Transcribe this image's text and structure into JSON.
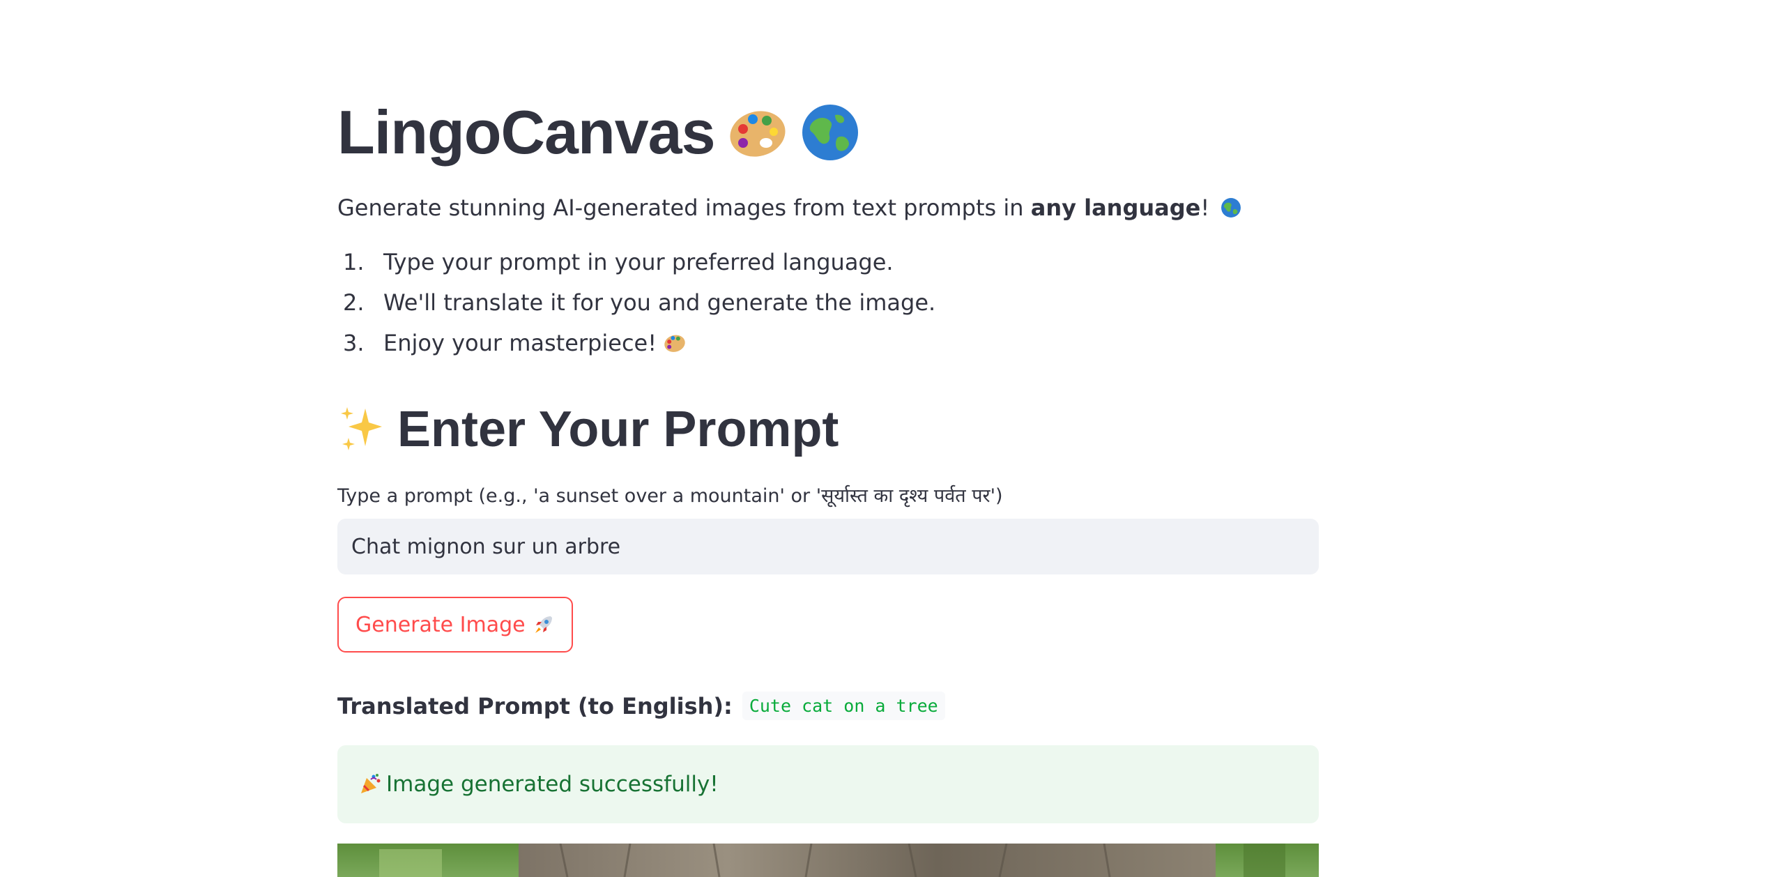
{
  "header": {
    "title": "LingoCanvas",
    "title_icons": [
      "palette-icon",
      "globe-icon"
    ]
  },
  "intro": {
    "text_before": "Generate stunning AI-generated images from text prompts in ",
    "bold": "any language",
    "text_after": "!",
    "icon": "globe-icon"
  },
  "steps": [
    {
      "num": "1.",
      "text": "Type your prompt in your preferred language."
    },
    {
      "num": "2.",
      "text": "We'll translate it for you and generate the image."
    },
    {
      "num": "3.",
      "text": "Enjoy your masterpiece!"
    }
  ],
  "prompt_section": {
    "title": "Enter Your Prompt",
    "icon": "sparkles-icon",
    "input_label": "Type a prompt (e.g., 'a sunset over a mountain' or 'सूर्यास्त का दृश्य पर्वत पर')",
    "input_value": "Chat mignon sur un arbre"
  },
  "generate_button": {
    "label": "Generate Image",
    "icon": "rocket-icon"
  },
  "translation": {
    "label": "Translated Prompt (to English):",
    "value": "Cute cat on a tree"
  },
  "success": {
    "message": "Image generated successfully!",
    "icon": "party-popper-icon"
  },
  "colors": {
    "text": "#31333f",
    "accent": "#ff4b4b",
    "input_bg": "#f0f2f6",
    "success_bg": "#edf8ef",
    "success_text": "#177233",
    "code_text": "#09ab3b"
  }
}
